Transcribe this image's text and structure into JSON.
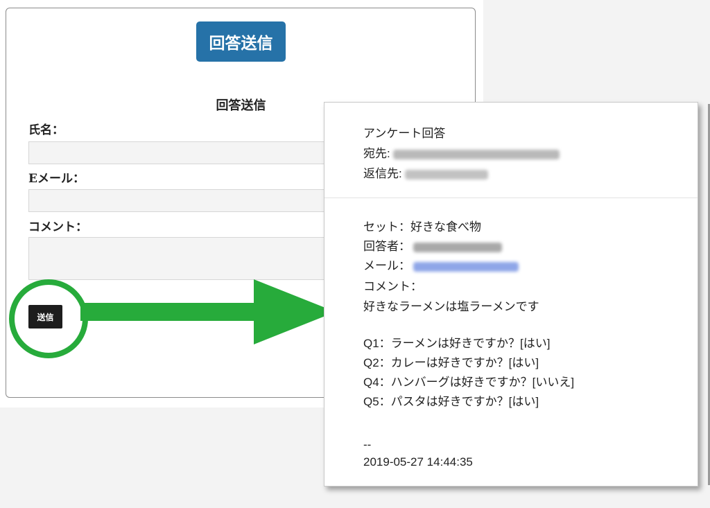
{
  "form": {
    "header_button_label": "回答送信",
    "title": "回答送信",
    "name_label": "氏名：",
    "email_label": "Eメール：",
    "comment_label": "コメント：",
    "submit_label": "送信"
  },
  "email": {
    "subject": "アンケート回答",
    "to_label": "宛先:",
    "reply_to_label": "返信先:",
    "set_line": "セット：好きな食べ物",
    "respondent_label": "回答者：",
    "mail_label": "メール：",
    "comment_label": "コメント：",
    "comment_text": "好きなラーメンは塩ラーメンです",
    "answers": [
      "Q1：ラーメンは好きですか？[はい]",
      "Q2：カレーは好きですか？[はい]",
      "Q4：ハンバーグは好きですか？[いいえ]",
      "Q5：パスタは好きですか？[はい]"
    ],
    "signature_dash": "--",
    "timestamp": "2019-05-27 14:44:35"
  },
  "colors": {
    "header_button": "#2672a8",
    "highlight_green": "#27ab3b",
    "submit_button": "#1d1d1d"
  }
}
